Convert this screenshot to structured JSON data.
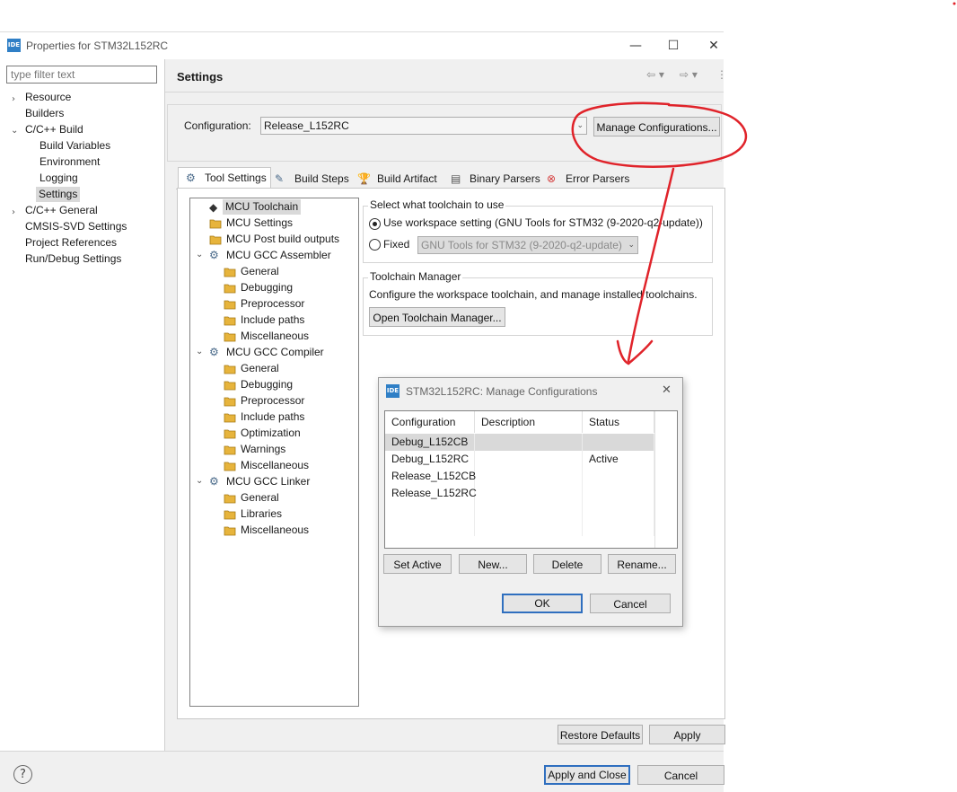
{
  "window": {
    "title": "Properties for STM32L152RC",
    "logo_text": "IDE",
    "minimize": "—",
    "maximize": "☐",
    "close": "✕"
  },
  "sidebar": {
    "filter_placeholder": "type filter text",
    "items": [
      {
        "label": "Resource"
      },
      {
        "label": "Builders"
      },
      {
        "label": "C/C++ Build"
      },
      {
        "label": "Build Variables"
      },
      {
        "label": "Environment"
      },
      {
        "label": "Logging"
      },
      {
        "label": "Settings"
      },
      {
        "label": "C/C++ General"
      },
      {
        "label": "CMSIS-SVD Settings"
      },
      {
        "label": "Project References"
      },
      {
        "label": "Run/Debug Settings"
      }
    ]
  },
  "main": {
    "title": "Settings",
    "configuration_label": "Configuration:",
    "configuration_value": "Release_L152RC",
    "manage_button": "Manage Configurations...",
    "tabs": [
      {
        "label": "Tool Settings"
      },
      {
        "label": "Build Steps"
      },
      {
        "label": "Build Artifact"
      },
      {
        "label": "Binary Parsers"
      },
      {
        "label": "Error Parsers"
      }
    ]
  },
  "tool_tree": [
    {
      "label": "MCU Toolchain"
    },
    {
      "label": "MCU Settings"
    },
    {
      "label": "MCU Post build outputs"
    },
    {
      "label": "MCU GCC Assembler"
    },
    {
      "label": "General"
    },
    {
      "label": "Debugging"
    },
    {
      "label": "Preprocessor"
    },
    {
      "label": "Include paths"
    },
    {
      "label": "Miscellaneous"
    },
    {
      "label": "MCU GCC Compiler"
    },
    {
      "label": "General"
    },
    {
      "label": "Debugging"
    },
    {
      "label": "Preprocessor"
    },
    {
      "label": "Include paths"
    },
    {
      "label": "Optimization"
    },
    {
      "label": "Warnings"
    },
    {
      "label": "Miscellaneous"
    },
    {
      "label": "MCU GCC Linker"
    },
    {
      "label": "General"
    },
    {
      "label": "Libraries"
    },
    {
      "label": "Miscellaneous"
    }
  ],
  "toolchain": {
    "group_title": "Select what toolchain to use",
    "workspace_option": "Use workspace setting (GNU Tools for STM32 (9-2020-q2-update))",
    "fixed_option": "Fixed",
    "fixed_value": "GNU Tools for STM32 (9-2020-q2-update)",
    "manager_title": "Toolchain Manager",
    "manager_desc": "Configure the workspace toolchain, and manage installed toolchains.",
    "manager_button": "Open Toolchain Manager..."
  },
  "dialog": {
    "title": "STM32L152RC: Manage Configurations",
    "columns": [
      "Configuration",
      "Description",
      "Status"
    ],
    "rows": [
      {
        "configuration": "Debug_L152CB",
        "description": "",
        "status": ""
      },
      {
        "configuration": "Debug_L152RC",
        "description": "",
        "status": "Active"
      },
      {
        "configuration": "Release_L152CB",
        "description": "",
        "status": ""
      },
      {
        "configuration": "Release_L152RC",
        "description": "",
        "status": ""
      }
    ],
    "buttons": {
      "set_active": "Set Active",
      "new": "New...",
      "delete": "Delete",
      "rename": "Rename...",
      "ok": "OK",
      "cancel": "Cancel"
    }
  },
  "footer": {
    "restore_defaults": "Restore Defaults",
    "apply": "Apply",
    "apply_and_close": "Apply and Close",
    "cancel": "Cancel",
    "help": "?"
  },
  "colors": {
    "annotation": "#e0232a",
    "accent": "#2f6fbf",
    "folder": "#e7b43c"
  }
}
